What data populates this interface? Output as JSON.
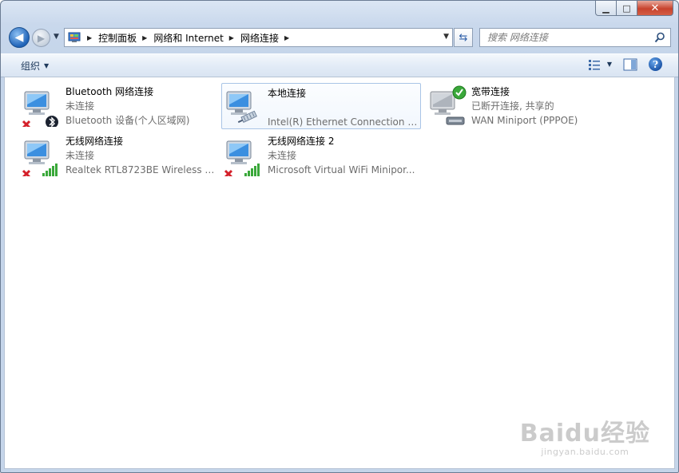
{
  "window": {
    "buttons": {
      "minimize": "▁",
      "maximize": "□",
      "close": "✕"
    }
  },
  "nav": {
    "back_glyph": "◀",
    "forward_glyph": "▶",
    "recent_glyph": "▼",
    "breadcrumb": [
      "控制面板",
      "网络和 Internet",
      "网络连接"
    ],
    "breadcrumb_sep": "▶",
    "refresh_glyph": "⇆",
    "search_placeholder": "搜索 网络连接"
  },
  "toolbar": {
    "organize_label": "组织",
    "caret": "▼",
    "help_glyph": "?"
  },
  "connections": [
    {
      "name": "Bluetooth 网络连接",
      "status": "未连接",
      "device": "Bluetooth 设备(个人区域网)",
      "state": "disconnected",
      "type": "bluetooth"
    },
    {
      "name": "本地连接",
      "status": "",
      "device": "Intel(R) Ethernet Connection I2...",
      "state": "connected",
      "type": "ethernet",
      "selected": true
    },
    {
      "name": "宽带连接",
      "status": "已断开连接, 共享的",
      "device": "WAN Miniport (PPPOE)",
      "state": "ok",
      "type": "broadband"
    },
    {
      "name": "无线网络连接",
      "status": "未连接",
      "device": "Realtek RTL8723BE Wireless L...",
      "state": "disconnected",
      "type": "wireless"
    },
    {
      "name": "无线网络连接 2",
      "status": "未连接",
      "device": "Microsoft Virtual WiFi Minipor...",
      "state": "disconnected",
      "type": "wireless"
    }
  ],
  "watermark": {
    "main": "Baidu经验",
    "sub": "jingyan.baidu.com"
  },
  "colors": {
    "accent": "#1f63b8",
    "close": "#c7432d",
    "error": "#d4202a",
    "ok": "#3aa83a"
  }
}
